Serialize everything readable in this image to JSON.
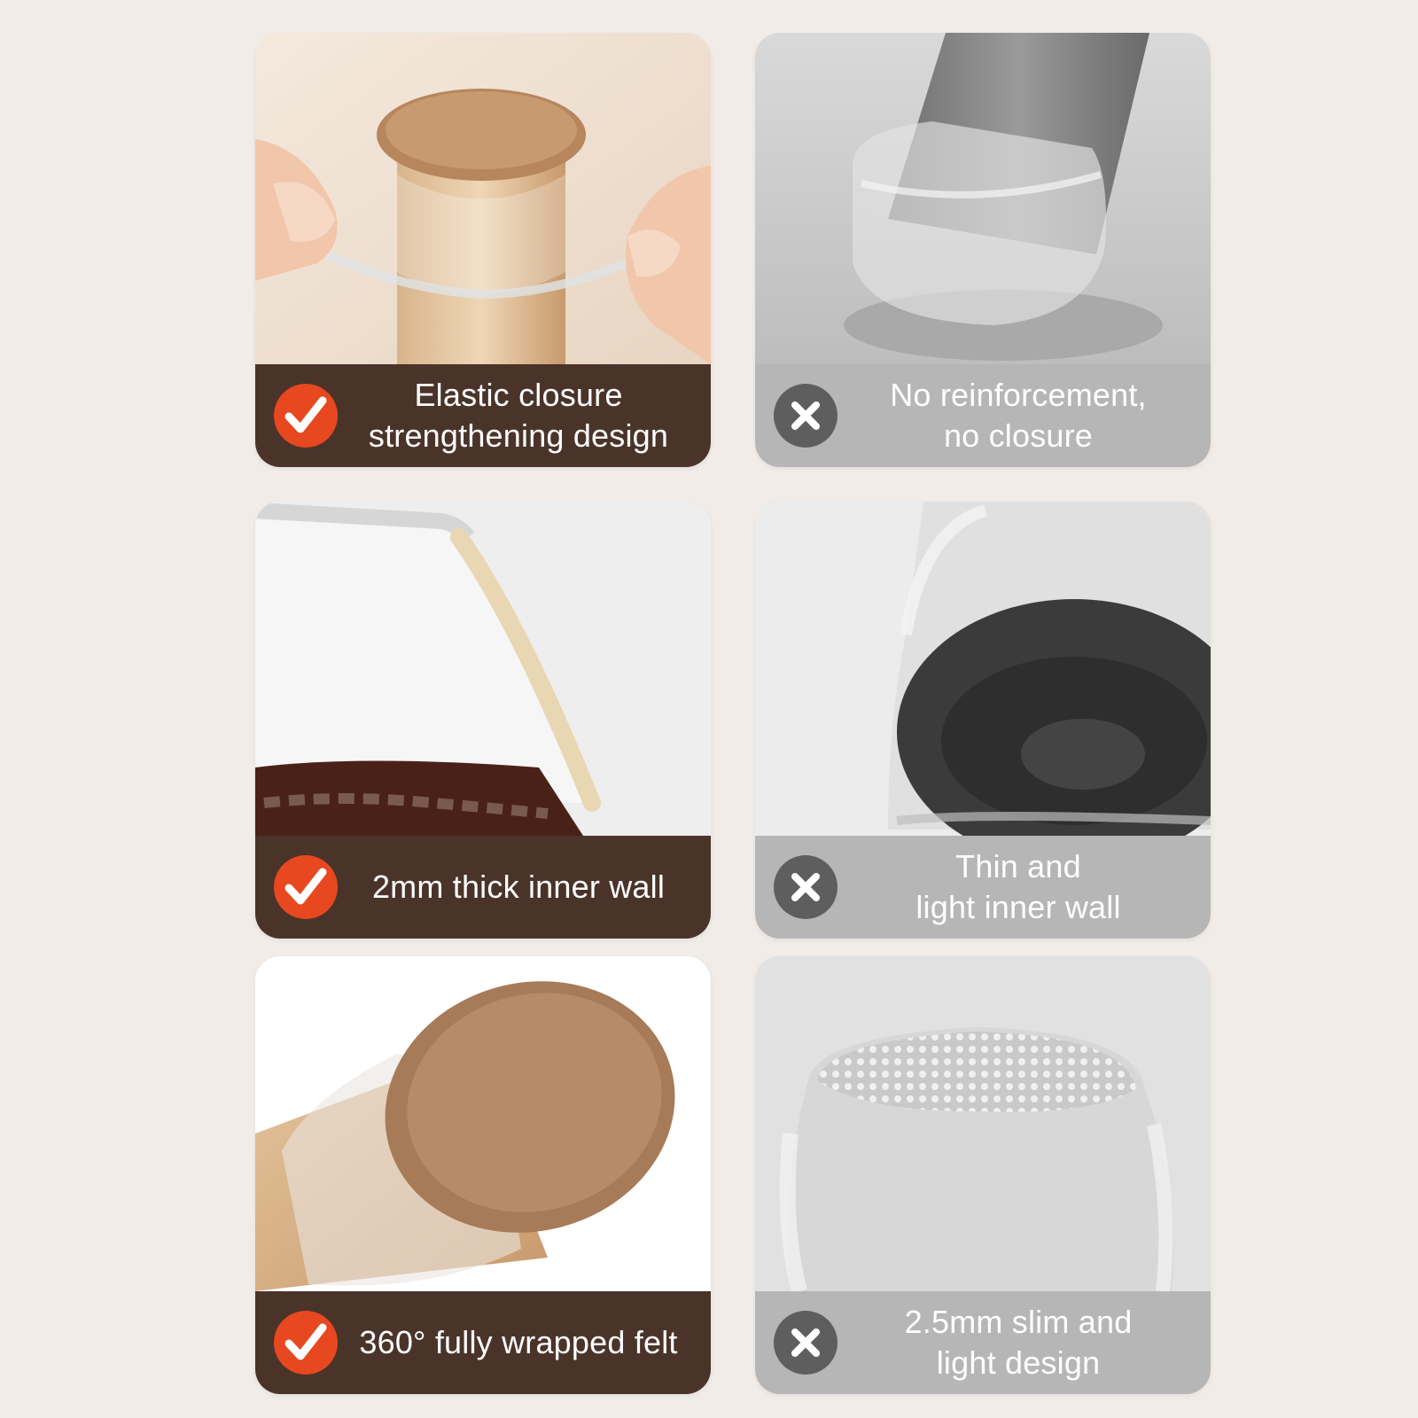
{
  "colors": {
    "background": "#f1ece8",
    "good_bar": "#4a342a",
    "bad_bar": "#b7b6b6",
    "check_badge": "#e8481f",
    "cross_badge": "#5e5e5e"
  },
  "cards": [
    {
      "kind": "good",
      "badge_icon": "check-icon",
      "lines": [
        "Elastic closure",
        "strengthening design"
      ]
    },
    {
      "kind": "bad",
      "badge_icon": "cross-icon",
      "lines": [
        "No reinforcement,",
        "no closure"
      ]
    },
    {
      "kind": "good",
      "badge_icon": "check-icon",
      "lines": [
        "2mm thick inner wall"
      ]
    },
    {
      "kind": "bad",
      "badge_icon": "cross-icon",
      "lines": [
        "Thin and",
        "light inner wall"
      ]
    },
    {
      "kind": "good",
      "badge_icon": "check-icon",
      "lines": [
        "360° fully wrapped felt"
      ]
    },
    {
      "kind": "bad",
      "badge_icon": "cross-icon",
      "lines": [
        "2.5mm slim and",
        "light design"
      ]
    }
  ]
}
